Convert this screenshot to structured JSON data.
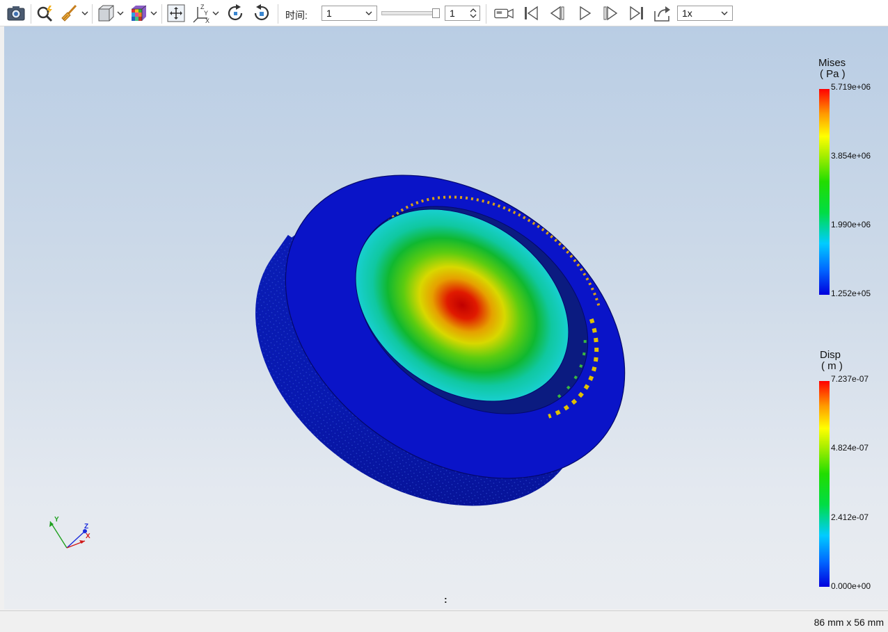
{
  "toolbar": {
    "icons": [
      "camera-icon",
      "probe-icon",
      "broom-icon",
      "view-cube-icon",
      "color-grid-icon",
      "fit-view-icon",
      "axes-icon",
      "rotate-cw-icon",
      "rotate-ccw-icon",
      "camera-record-icon",
      "first-frame-icon",
      "step-back-icon",
      "play-icon",
      "step-forward-icon",
      "last-frame-icon",
      "export-icon"
    ],
    "time_label": "时间:",
    "time_select_value": "1",
    "frame_spin_value": "1",
    "speed_select_value": "1x"
  },
  "viewport": {
    "triad": {
      "x_label": "X",
      "y_label": "Y",
      "z_label": "Z"
    },
    "center_mark": ":"
  },
  "legends": [
    {
      "title": "Mises",
      "unit": "( Pa )",
      "ticks": [
        "5.719e+06",
        "3.854e+06",
        "1.990e+06",
        "1.252e+05"
      ]
    },
    {
      "title": "Disp",
      "unit": "( m )",
      "ticks": [
        "7.237e-07",
        "4.824e-07",
        "2.412e-07",
        "0.000e+00"
      ]
    }
  ],
  "colors": {
    "colormap": [
      "#0000dd",
      "#00ccff",
      "#00dd00",
      "#ffff00",
      "#ff0000"
    ],
    "model_blue": "#0a14c8",
    "hotspot_red": "#c00000"
  },
  "statusbar": {
    "size_text": "86 mm x 56 mm"
  }
}
